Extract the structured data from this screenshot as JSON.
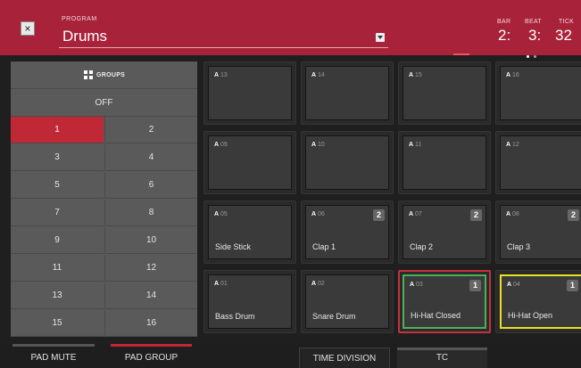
{
  "header": {
    "close_icon": "×",
    "program_label": "PROGRAM",
    "program_name": "Drums",
    "counter": {
      "bar_label": "BAR",
      "bar_value": "2:",
      "beat_label": "BEAT",
      "beat_value": "3:",
      "tick_label": "TICK",
      "tick_value": "32"
    }
  },
  "groups": {
    "title": "GROUPS",
    "off_label": "OFF",
    "items": [
      "1",
      "2",
      "3",
      "4",
      "5",
      "6",
      "7",
      "8",
      "9",
      "10",
      "11",
      "12",
      "13",
      "14",
      "15",
      "16"
    ],
    "selected": "1"
  },
  "pads": [
    {
      "bank": "A",
      "num": "13",
      "name": "",
      "badge": ""
    },
    {
      "bank": "A",
      "num": "14",
      "name": "",
      "badge": ""
    },
    {
      "bank": "A",
      "num": "15",
      "name": "",
      "badge": ""
    },
    {
      "bank": "A",
      "num": "16",
      "name": "",
      "badge": ""
    },
    {
      "bank": "A",
      "num": "09",
      "name": "",
      "badge": ""
    },
    {
      "bank": "A",
      "num": "10",
      "name": "",
      "badge": ""
    },
    {
      "bank": "A",
      "num": "11",
      "name": "",
      "badge": ""
    },
    {
      "bank": "A",
      "num": "12",
      "name": "",
      "badge": ""
    },
    {
      "bank": "A",
      "num": "05",
      "name": "Side Stick",
      "badge": ""
    },
    {
      "bank": "A",
      "num": "06",
      "name": "Clap 1",
      "badge": "2"
    },
    {
      "bank": "A",
      "num": "07",
      "name": "Clap 2",
      "badge": "2"
    },
    {
      "bank": "A",
      "num": "08",
      "name": "Clap 3",
      "badge": "2"
    },
    {
      "bank": "A",
      "num": "01",
      "name": "Bass Drum",
      "badge": ""
    },
    {
      "bank": "A",
      "num": "02",
      "name": "Snare Drum",
      "badge": ""
    },
    {
      "bank": "A",
      "num": "03",
      "name": "Hi-Hat Closed",
      "badge": "1"
    },
    {
      "bank": "A",
      "num": "04",
      "name": "Hi-Hat Open",
      "badge": "1"
    }
  ],
  "tabs": {
    "pad_mute": "PAD MUTE",
    "pad_group": "PAD GROUP",
    "time_division": "TIME DIVISION",
    "tc": "TC"
  },
  "colors": {
    "header": "#a8223a",
    "group_selected": "#c02836",
    "pad_selected_outer": "#c8303c",
    "pad_selected_inner": "#4cb05a",
    "pad_highlight": "#e8e020"
  }
}
